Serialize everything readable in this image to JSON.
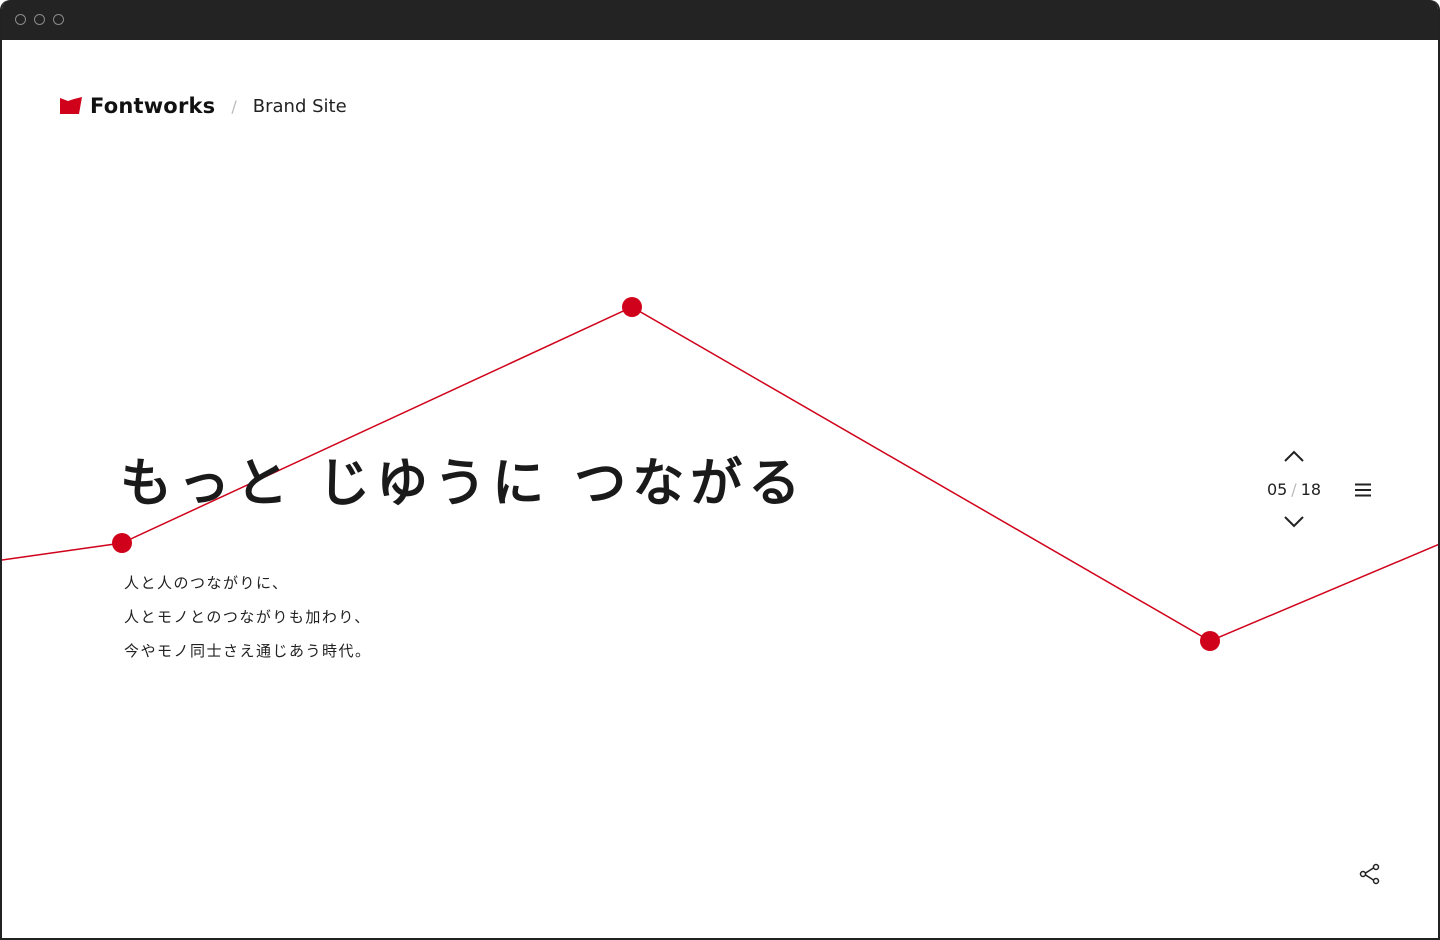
{
  "header": {
    "brand": "Fontworks",
    "separator": "/",
    "subsite": "Brand Site"
  },
  "hero": {
    "headline": "もっと じゆうに つながる",
    "body_lines": [
      "人と人のつながりに、",
      "人とモノとのつながりも加わり、",
      "今やモノ同士さえ通じあう時代。"
    ]
  },
  "pager": {
    "current": "05",
    "separator": "/",
    "total": "18"
  },
  "icons": {
    "logo": "fontworks-logo-icon",
    "up": "chevron-up-icon",
    "down": "chevron-down-icon",
    "menu": "hamburger-menu-icon",
    "share": "share-icon"
  },
  "colors": {
    "accent": "#d0021b",
    "text": "#1a1a1a",
    "titlebar": "#232323"
  }
}
